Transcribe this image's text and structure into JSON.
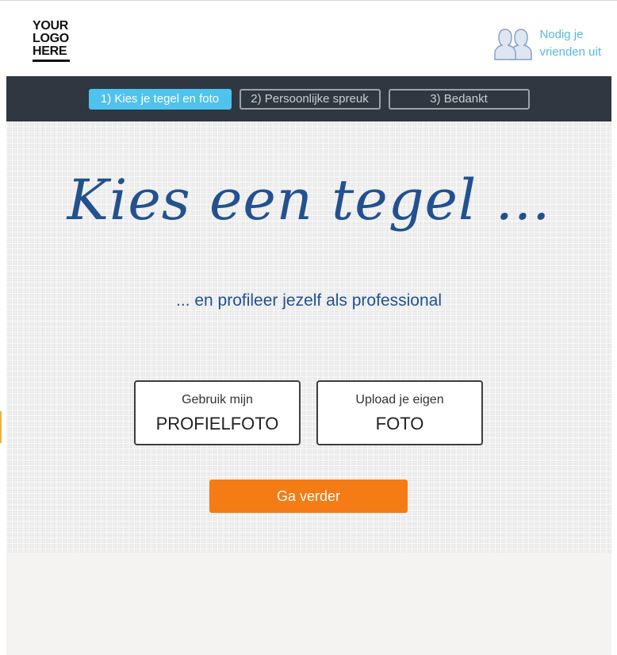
{
  "logo": {
    "lines": [
      "YOUR",
      "LOGO",
      "HERE"
    ]
  },
  "header": {
    "invite": {
      "line1": "Nodig je",
      "line2": "vrienden uit",
      "icon": "friends-icon"
    }
  },
  "steps": [
    {
      "label": "1) Kies je tegel en foto",
      "active": true
    },
    {
      "label": "2) Persoonlijke spreuk",
      "active": false
    },
    {
      "label": "3) Bedankt",
      "active": false
    }
  ],
  "hero": {
    "title": "Kies een tegel ...",
    "subtitle": "... en profileer jezelf als professional",
    "options": [
      {
        "small": "Gebruik mijn",
        "big": "PROFIELFOTO"
      },
      {
        "small": "Upload je eigen",
        "big": "FOTO"
      }
    ],
    "continue_label": "Ga verder"
  },
  "colors": {
    "accent_blue": "#4fc2ee",
    "title_blue": "#22518f",
    "button_orange": "#f57b14",
    "stepbar_bg": "#2f3740"
  }
}
